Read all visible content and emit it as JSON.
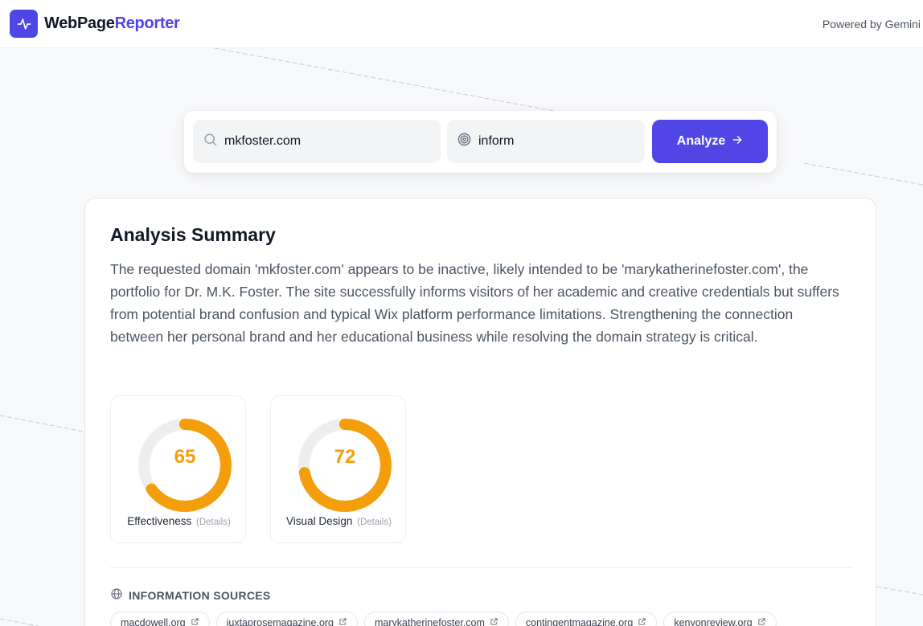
{
  "header": {
    "brand_primary": "WebPage",
    "brand_accent": "Reporter",
    "powered_by": "Powered by Gemini"
  },
  "search": {
    "url_value": "mkfoster.com",
    "goal_value": "inform",
    "analyze_label": "Analyze"
  },
  "summary": {
    "title": "Analysis Summary",
    "text": "The requested domain 'mkfoster.com' appears to be inactive, likely intended to be 'marykatherinefoster.com', the portfolio for Dr. M.K. Foster. The site successfully informs visitors of her academic and creative credentials but suffers from potential brand confusion and typical Wix platform performance limitations. Strengthening the connection between her personal brand and her educational business while resolving the domain strategy is critical."
  },
  "scores": [
    {
      "value": "65",
      "fraction": 0.65,
      "label": "Effectiveness",
      "details": "(Details)"
    },
    {
      "value": "72",
      "fraction": 0.72,
      "label": "Visual Design",
      "details": "(Details)"
    }
  ],
  "sources": {
    "heading": "INFORMATION SOURCES",
    "items": [
      "macdowell.org",
      "juxtaprosemagazine.org",
      "marykatherinefoster.com",
      "contingentmagazine.org",
      "kenyonreview.org"
    ]
  },
  "colors": {
    "accent": "#4f46e5",
    "score": "#f59e0b",
    "gauge_track": "#eeeeee"
  },
  "icons": {
    "logo": "activity-pulse-icon",
    "url": "search-icon",
    "goal": "target-icon",
    "analyze": "arrow-right-icon",
    "sources": "globe-icon",
    "chip": "external-link-icon"
  }
}
